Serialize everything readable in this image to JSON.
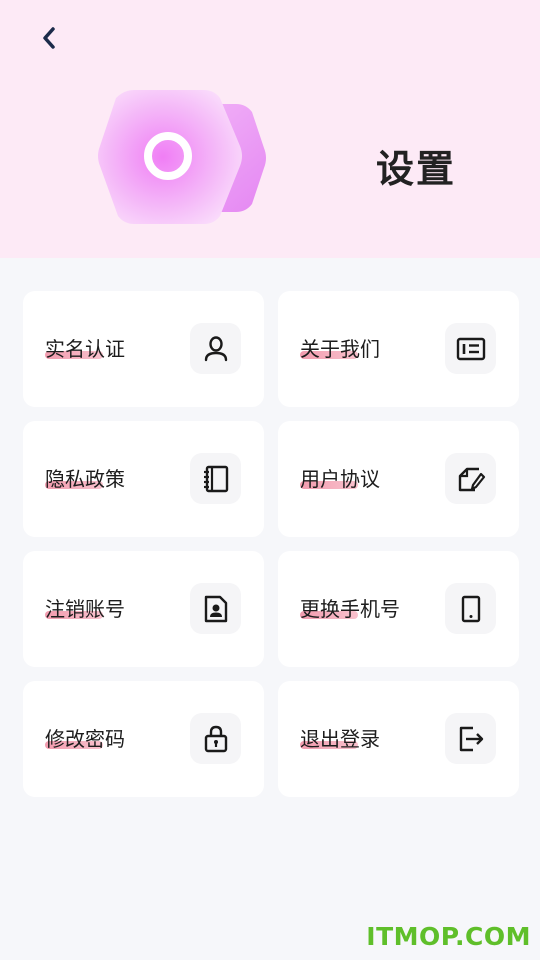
{
  "header": {
    "title": "设置",
    "back_icon": "chevron-left-icon"
  },
  "colors": {
    "header_bg": "#fdeaf6",
    "page_bg": "#f6f7fa",
    "accent_pink": "#f08aa0",
    "hero_purple": "#e89cf5",
    "watermark_green": "#5fbf2a"
  },
  "menu": {
    "items": [
      {
        "label": "实名认证",
        "icon": "user-id-icon"
      },
      {
        "label": "关于我们",
        "icon": "id-card-icon"
      },
      {
        "label": "隐私政策",
        "icon": "notebook-icon"
      },
      {
        "label": "用户协议",
        "icon": "edit-document-icon"
      },
      {
        "label": "注销账号",
        "icon": "contact-file-icon"
      },
      {
        "label": "更换手机号",
        "icon": "phone-icon"
      },
      {
        "label": "修改密码",
        "icon": "lock-icon"
      },
      {
        "label": "退出登录",
        "icon": "logout-icon"
      }
    ]
  },
  "watermark": "ITMOP.COM"
}
